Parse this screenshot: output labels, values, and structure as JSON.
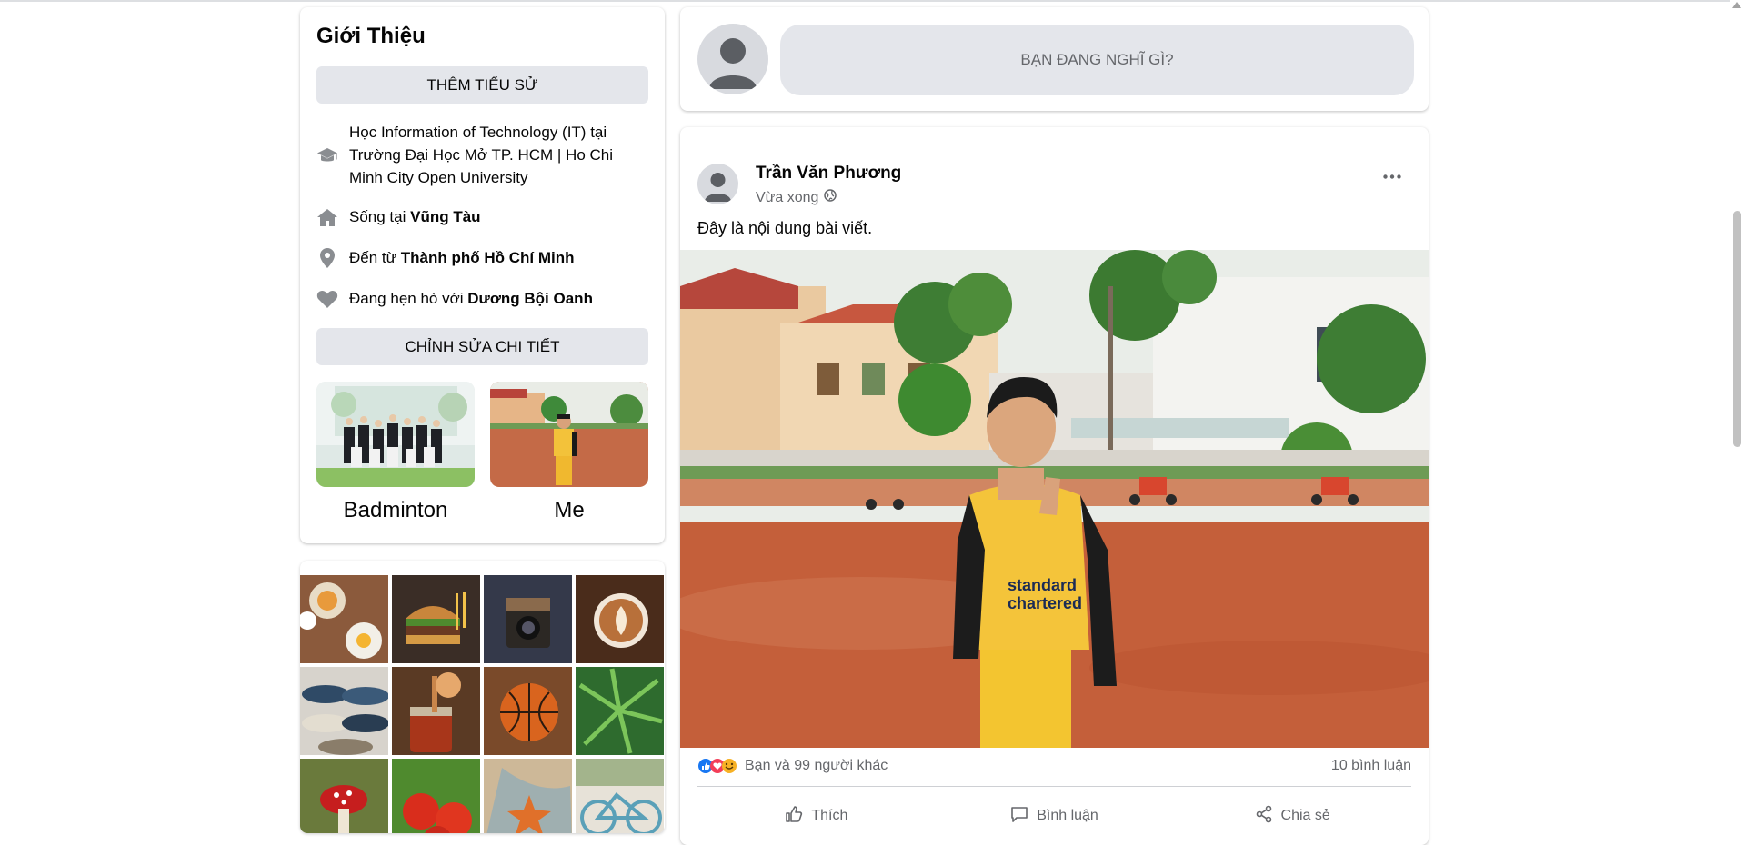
{
  "intro": {
    "title": "Giới Thiệu",
    "add_bio_label": "THÊM TIỂU SỬ",
    "edit_details_label": "CHỈNH SỬA CHI TIẾT",
    "items": [
      {
        "icon": "graduation-cap-icon",
        "text": "Học Information of Technology (IT) tại Trường Đại Học Mở TP. HCM | Ho Chi Minh City Open University",
        "bold": ""
      },
      {
        "icon": "home-icon",
        "text": "Sống tại ",
        "bold": "Vũng Tàu"
      },
      {
        "icon": "location-pin-icon",
        "text": "Đến từ ",
        "bold": "Thành phố Hồ Chí Minh"
      },
      {
        "icon": "heart-icon",
        "text": "Đang hẹn hò với ",
        "bold": "Dương Bội Oanh"
      }
    ],
    "featured": [
      {
        "caption": "Badminton"
      },
      {
        "caption": "Me"
      }
    ]
  },
  "composer": {
    "placeholder": "BẠN ĐANG NGHĨ GÌ?"
  },
  "post": {
    "author": "Trần Văn Phương",
    "time": "Vừa xong",
    "privacy_icon": "globe-icon",
    "text": "Đây là nội dung bài viết.",
    "reactions_summary": "Bạn và 99 người khác",
    "comments_count": "10 bình luận",
    "actions": {
      "like": "Thích",
      "comment": "Bình luận",
      "share": "Chia sẻ"
    }
  },
  "colors": {
    "button_gray": "#e4e6eb",
    "secondary_text": "#65676b",
    "like_blue": "#1877f2",
    "love_red": "#f33e58",
    "haha_yellow": "#f7b125"
  }
}
